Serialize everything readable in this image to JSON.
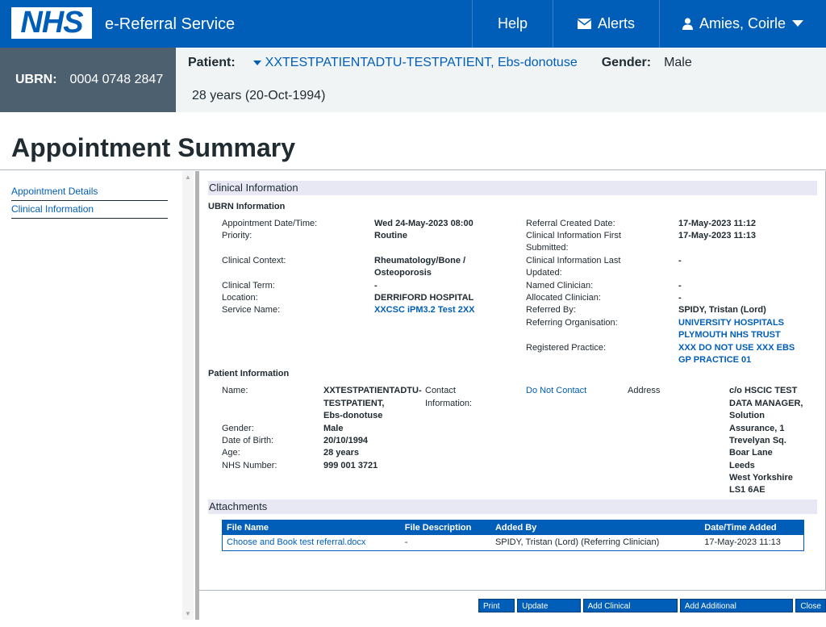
{
  "header": {
    "logo_text": "NHS",
    "service_name": "e-Referral Service",
    "help_label": "Help",
    "alerts_label": "Alerts",
    "user_name": "Amies, Coirle"
  },
  "banner": {
    "ubrn_label": "UBRN:",
    "ubrn_value": "0004 0748 2847",
    "patient_label": "Patient:",
    "patient_name": "XXTESTPATIENTADTU-TESTPATIENT, Ebs-donotuse",
    "gender_label": "Gender:",
    "gender_value": "Male",
    "age": "28 years (20-Oct-1994)"
  },
  "page_title": "Appointment Summary",
  "sidenav": [
    "Appointment Details",
    "Clinical Information"
  ],
  "clinical": {
    "section_title": "Clinical Information",
    "ubrn_heading": "UBRN Information",
    "appt_date_label": "Appointment Date/Time:",
    "appt_date": "Wed 24-May-2023 08:00",
    "priority_label": "Priority:",
    "priority": "Routine",
    "context_label": "Clinical Context:",
    "context_1": "Rheumatology/Bone /",
    "context_2": "Osteoporosis",
    "term_label": "Clinical Term:",
    "term": "-",
    "location_label": "Location:",
    "location": "DERRIFORD HOSPITAL",
    "service_label": "Service Name:",
    "service": "XXCSC iPM3.2 Test 2XX",
    "created_label": "Referral Created Date:",
    "created": "17-May-2023 11:12",
    "first_sub_label_1": "Clinical Information First",
    "first_sub_label_2": "Submitted:",
    "first_sub": "17-May-2023 11:13",
    "last_upd_label_1": "Clinical Information Last",
    "last_upd_label_2": "Updated:",
    "last_upd": "-",
    "named_label": "Named Clinician:",
    "named": "-",
    "allocated_label": "Allocated Clinician:",
    "allocated": "-",
    "referred_by_label": "Referred By:",
    "referred_by": "SPIDY, Tristan (Lord)",
    "ref_org_label": "Referring Organisation:",
    "ref_org_1": "UNIVERSITY HOSPITALS",
    "ref_org_2": "PLYMOUTH NHS TRUST",
    "practice_label": "Registered Practice:",
    "practice_1": "XXX DO NOT USE XXX EBS",
    "practice_2": "GP PRACTICE 01"
  },
  "patient": {
    "heading": "Patient Information",
    "name_label": "Name:",
    "name_1": "XXTESTPATIENTADTU-",
    "name_2": "TESTPATIENT,",
    "name_3": "Ebs-donotuse",
    "contact_label_1": "Contact",
    "contact_label_2": "Information:",
    "contact_value": "Do Not Contact",
    "address_label": "Address",
    "address": [
      "c/o HSCIC TEST",
      "DATA MANAGER,",
      "Solution",
      "Assurance, 1",
      "Trevelyan Sq.",
      "Boar Lane",
      "Leeds",
      "West Yorkshire",
      "LS1 6AE"
    ],
    "gender_label": "Gender:",
    "gender": "Male",
    "dob_label": "Date of Birth:",
    "dob": "20/10/1994",
    "age_label": "Age:",
    "age": "28 years",
    "nhs_label": "NHS Number:",
    "nhs": "999 001 3721"
  },
  "attachments": {
    "title": "Attachments",
    "headers": [
      "File Name",
      "File Description",
      "Added By",
      "Date/Time Added"
    ],
    "rows": [
      [
        "Choose and Book test referral.docx",
        "-",
        "SPIDY, Tristan (Lord) (Referring Clinician)",
        "17-May-2023 11:13"
      ]
    ]
  },
  "buttons": {
    "print": "Print ▼",
    "update_person": "Update Person",
    "add_clinical": "Add Clinical Information",
    "add_requirements": "Add Additional Requirements",
    "close": "Close"
  }
}
